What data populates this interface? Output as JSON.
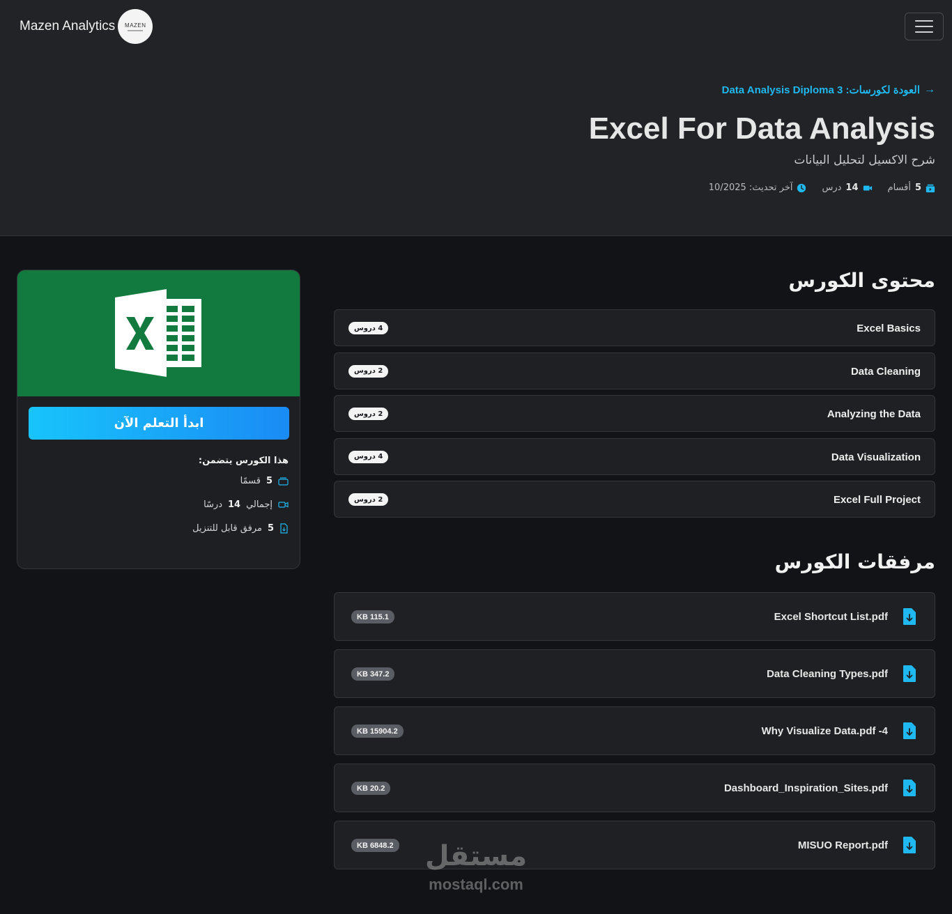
{
  "navbar": {
    "brand_name": "Mazen Analytics",
    "logo_text": "MAZEN"
  },
  "hero": {
    "back_link": "العودة لكورسات: Data Analysis Diploma 3",
    "title": "Excel For Data Analysis",
    "subtitle": "شرح الاكسيل لتحليل البيانات",
    "meta": {
      "sections_count": "5",
      "sections_label": "أقسام",
      "lessons_count": "14",
      "lessons_label": "درس",
      "updated_label": "آخر تحديث: 10/2025"
    }
  },
  "card": {
    "thumb_color": "#127a3e",
    "start_button": "ابدأ التعلم الآن",
    "includes_title": "هذا الكورس يتضمن:",
    "includes": [
      {
        "count": "5",
        "text": "قسمًا",
        "icon": "layers-icon"
      },
      {
        "prefix": "إجمالي",
        "count": "14",
        "text": "درسًا",
        "icon": "video-icon"
      },
      {
        "count": "5",
        "text": "مرفق قابل للتنزيل",
        "icon": "file-download-icon"
      }
    ]
  },
  "content": {
    "heading": "محتوى الكورس",
    "modules": [
      {
        "title": "Excel Basics",
        "badge": "4 دروس"
      },
      {
        "title": "Data Cleaning",
        "badge": "2 دروس"
      },
      {
        "title": "Analyzing the Data",
        "badge": "2 دروس"
      },
      {
        "title": "Data Visualization",
        "badge": "4 دروس"
      },
      {
        "title": "Excel Full Project",
        "badge": "2 دروس"
      }
    ]
  },
  "attachments": {
    "heading": "مرفقات الكورس",
    "files": [
      {
        "name": "Excel Shortcut List.pdf",
        "size": "KB 115.1"
      },
      {
        "name": "Data Cleaning Types.pdf",
        "size": "KB 347.2"
      },
      {
        "name": "Why Visualize Data.pdf -4",
        "size": "KB 15904.2"
      },
      {
        "name": "Dashboard_Inspiration_Sites.pdf",
        "size": "KB 20.2"
      },
      {
        "name": "MISUO Report.pdf",
        "size": "KB 6848.2"
      }
    ]
  },
  "watermark": {
    "ar": "مستقل",
    "en": "mostaql.com"
  },
  "colors": {
    "accent": "#1fb8f0",
    "excel_green": "#127a3e",
    "bg": "#121316"
  }
}
